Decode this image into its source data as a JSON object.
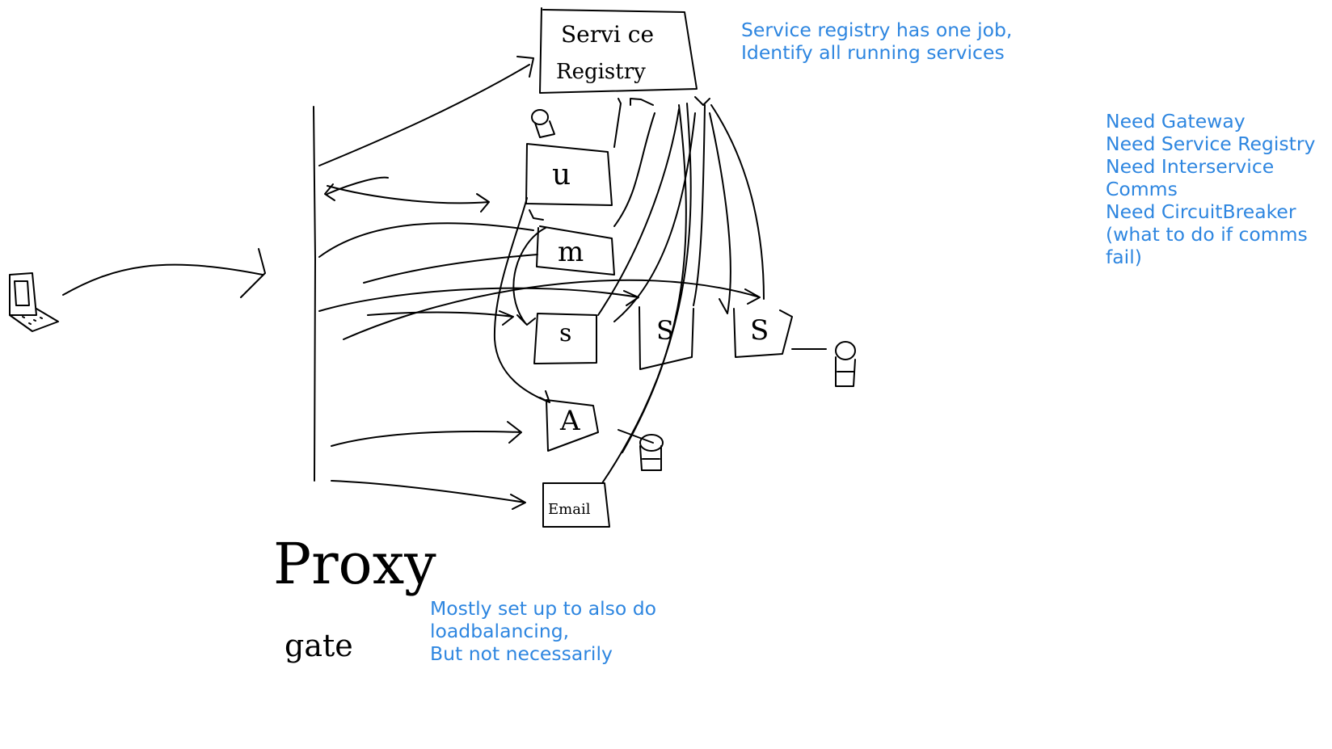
{
  "diagram": {
    "components": {
      "registry": {
        "line1": "Servi ce",
        "line2": "Registry"
      },
      "u": "u",
      "m": "m",
      "s1": "s",
      "s2": "S",
      "s3": "S",
      "a": "A",
      "email": "Email"
    },
    "proxy_label": "Proxy",
    "gate_label": "gate"
  },
  "notes": {
    "registry": [
      "Service registry has one job,",
      "Identify all running services"
    ],
    "needs": [
      "Need Gateway",
      "Need Service Registry",
      "Need Interservice",
      "Comms",
      "Need CircuitBreaker",
      "(what to do if comms",
      "fail)"
    ],
    "loadbalancing": [
      "Mostly set up to also do",
      "loadbalancing,",
      "But not necessarily"
    ]
  }
}
